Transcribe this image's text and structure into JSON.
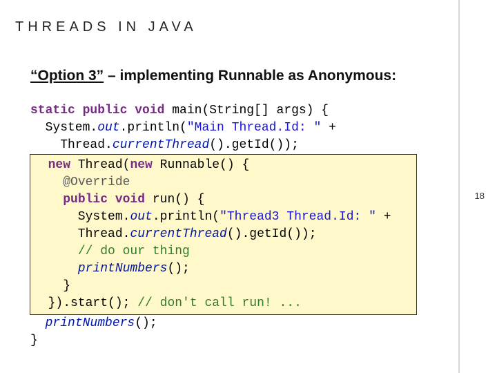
{
  "title": "THREADS IN JAVA",
  "heading": {
    "underlined": "“Option 3”",
    "rest": " – implementing Runnable as Anonymous:"
  },
  "code": {
    "l1a": "static public void",
    "l1b": " main(String[] args) {",
    "l2a": "  System.",
    "l2b": "out",
    "l2c": ".println(",
    "l2d": "\"Main Thread.Id: \"",
    "l2e": " +",
    "l3a": "    Thread.",
    "l3b": "currentThread",
    "l3c": "().getId());",
    "h1a": "  ",
    "h1b": "new",
    "h1c": " Thread(",
    "h1d": "new",
    "h1e": " Runnable() {                    ",
    "h2a": "    ",
    "h2b": "@Override",
    "h2c": "                                    ",
    "h3a": "    ",
    "h3b": "public void",
    "h3c": " run() {                          ",
    "h4a": "      System.",
    "h4b": "out",
    "h4c": ".println(",
    "h4d": "\"Thread3 Thread.Id: \"",
    "h4e": " +",
    "h5a": "      Thread.",
    "h5b": "currentThread",
    "h5c": "().getId());          ",
    "h6a": "      ",
    "h6b": "// do our thing",
    "h6c": "                            ",
    "h7a": "      ",
    "h7b": "printNumbers",
    "h7c": "();                              ",
    "h8": "    }                                            ",
    "h9a": "  }).start(); ",
    "h9b": "// don't call run! ...",
    "h9c": "           ",
    "l10a": "  ",
    "l10b": "printNumbers",
    "l10c": "();",
    "l11": "}"
  },
  "page_number": "18"
}
